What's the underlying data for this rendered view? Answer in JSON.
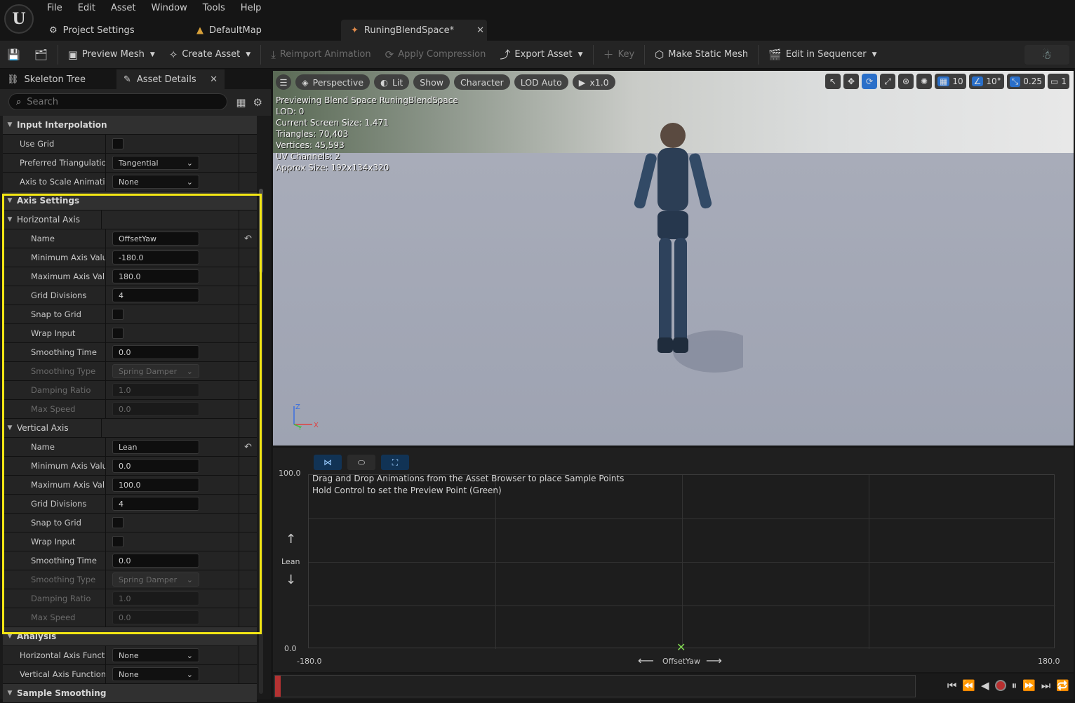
{
  "app": {
    "logo": "U"
  },
  "menu": [
    "File",
    "Edit",
    "Asset",
    "Window",
    "Tools",
    "Help"
  ],
  "tabs": [
    {
      "label": "Project Settings",
      "icon": "settings-icon"
    },
    {
      "label": "DefaultMap",
      "icon": "map-icon"
    },
    {
      "label": "RuningBlendSpace*",
      "icon": "blendspace-icon",
      "active": true
    }
  ],
  "toolbar": {
    "preview_mesh": "Preview Mesh",
    "create_asset": "Create Asset",
    "reimport": "Reimport Animation",
    "apply_compression": "Apply Compression",
    "export_asset": "Export Asset",
    "key": "Key",
    "make_static_mesh": "Make Static Mesh",
    "edit_in_sequencer": "Edit in Sequencer"
  },
  "panel_tabs": {
    "skeleton_tree": "Skeleton Tree",
    "asset_details": "Asset Details"
  },
  "search": {
    "placeholder": "Search"
  },
  "props": {
    "input_interpolation": "Input Interpolation",
    "use_grid": "Use Grid",
    "preferred_triangulation": "Preferred Triangulatio...",
    "preferred_triangulation_value": "Tangential",
    "axis_to_scale": "Axis to Scale Animation",
    "axis_to_scale_value": "None",
    "axis_settings": "Axis Settings",
    "horizontal_axis": "Horizontal Axis",
    "vertical_axis": "Vertical Axis",
    "h": {
      "name_label": "Name",
      "name": "OffsetYaw",
      "min_label": "Minimum Axis Value",
      "min": "-180.0",
      "max_label": "Maximum Axis Val...",
      "max": "180.0",
      "grid_label": "Grid Divisions",
      "grid": "4",
      "snap_label": "Snap to Grid",
      "wrap_label": "Wrap Input",
      "smooth_time_label": "Smoothing Time",
      "smooth_time": "0.0",
      "smooth_type_label": "Smoothing Type",
      "smooth_type": "Spring Damper",
      "damping_label": "Damping Ratio",
      "damping": "1.0",
      "maxspeed_label": "Max Speed",
      "maxspeed": "0.0"
    },
    "v": {
      "name_label": "Name",
      "name": "Lean",
      "min_label": "Minimum Axis Value",
      "min": "0.0",
      "max_label": "Maximum Axis Val...",
      "max": "100.0",
      "grid_label": "Grid Divisions",
      "grid": "4",
      "snap_label": "Snap to Grid",
      "wrap_label": "Wrap Input",
      "smooth_time_label": "Smoothing Time",
      "smooth_time": "0.0",
      "smooth_type_label": "Smoothing Type",
      "smooth_type": "Spring Damper",
      "damping_label": "Damping Ratio",
      "damping": "1.0",
      "maxspeed_label": "Max Speed",
      "maxspeed": "0.0"
    },
    "analysis": "Analysis",
    "h_func_label": "Horizontal Axis Function",
    "h_func": "None",
    "v_func_label": "Vertical Axis Function",
    "v_func": "None",
    "sample_smoothing": "Sample Smoothing"
  },
  "viewport": {
    "perspective": "Perspective",
    "lit": "Lit",
    "show": "Show",
    "character": "Character",
    "lod": "LOD Auto",
    "speed": "x1.0",
    "grid_snap": "10",
    "rot_snap": "10°",
    "scale_snap": "0.25",
    "camera_speed": "1",
    "stats": [
      "Previewing Blend Space RuningBlendSpace",
      "LOD: 0",
      "Current Screen Size: 1.471",
      "Triangles: 70,403",
      "Vertices: 45,593",
      "UV Channels: 2",
      "Approx Size: 192x134x320"
    ],
    "axis_z": "Z",
    "axis_x": "X",
    "axis_y": "Y"
  },
  "blendspace": {
    "hint1": "Drag and Drop Animations from the Asset Browser to place Sample Points",
    "hint2": "Hold Control to set the Preview Point (Green)",
    "y_max": "100.0",
    "y_min": "0.0",
    "x_min": "-180.0",
    "x_max": "180.0",
    "y_axis": "Lean",
    "x_axis": "OffsetYaw",
    "preview_point": {
      "x": 0.0,
      "y": 0.0
    }
  },
  "colors": {
    "highlight": "#f3e614",
    "accent_blue": "#2a6fc9",
    "preview_green": "#7fd350"
  }
}
